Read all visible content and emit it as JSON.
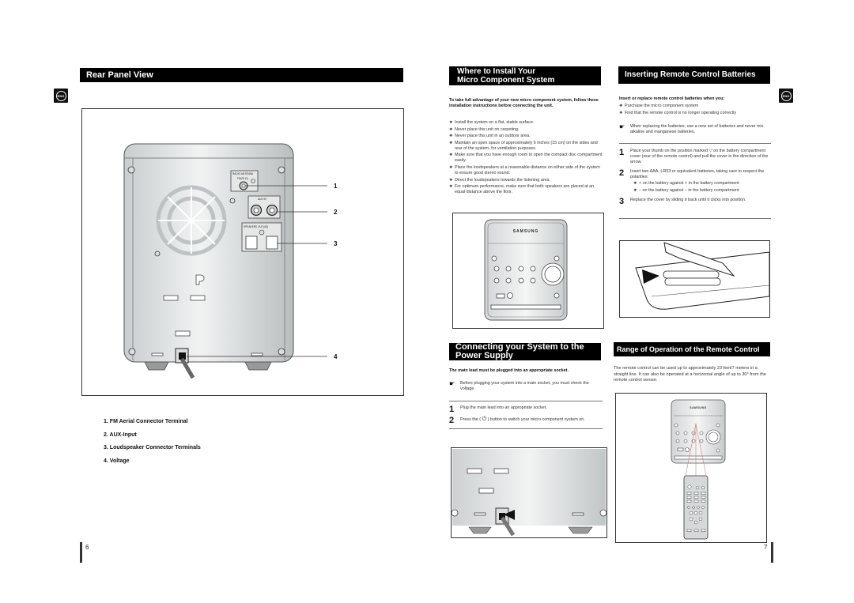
{
  "left_page": {
    "header": "Rear Panel View",
    "language_badge": "ENG",
    "figure": {
      "panel_labels": {
        "radio_antenna": "RADIO ANTENNA",
        "fm": "FM(75 Ω)",
        "aux_in": "AUX IN",
        "speakers_out": "SPEAKERS OUT(4Ω)"
      },
      "callouts": [
        "1",
        "2",
        "3",
        "4"
      ]
    },
    "legend": [
      {
        "num": "1.",
        "label": "FM Aerial Connector Terminal"
      },
      {
        "num": "2.",
        "label": "AUX-Input"
      },
      {
        "num": "3.",
        "label": "Loudspeaker Connector Terminals"
      },
      {
        "num": "4.",
        "label": "Voltage"
      }
    ],
    "page_number": "6"
  },
  "install": {
    "header_line1": "Where to Install Your",
    "header_line2": "Micro Component System",
    "intro": "To take full advantage of your new micro component system, follow these installation instructions before connecting the unit.",
    "bullets": [
      "Install the system on a flat, stable surface.",
      "Never place this unit on carpeting.",
      "Never place this unit in an outdoor area.",
      "Maintain an open space of approximately 6 inches (15 cm) on the sides and rear of the system, for ventilation purposes.",
      "Make sure that you have enough room to open the compact disc compartment easily.",
      "Place the loudspeakers at a reasonable distance on either side of the system to ensure good stereo sound.",
      "Direct the loudspeakers towards the listening area.",
      "For optimum performance, make sure that both speakers are placed at an equal distance above the floor."
    ],
    "brand": "SAMSUNG"
  },
  "power": {
    "header_line1": "Connecting your System to the",
    "header_line2": "Power Supply",
    "intro": "The main lead must be plugged into an appropriate socket.",
    "note": "Before plugging your system into a main socket, you must check the voltage.",
    "steps": [
      {
        "n": "1",
        "text": "Plug the main lead into an appropriate socket."
      },
      {
        "n": "2",
        "text_before": "Press the (",
        "text_after": ") button to switch your micro component system on."
      }
    ]
  },
  "batteries": {
    "header": "Inserting Remote Control Batteries",
    "language_badge": "ENG",
    "intro": "Insert or replace remote control batteries when you:",
    "bullets": [
      "Purchase the micro component system",
      "Find that the remote control is no longer operating correctly"
    ],
    "note": "When replacing the batteries, use a new set of batteries and never mix alkaline and manganese batteries.",
    "steps": [
      {
        "n": "1",
        "text": "Place your thumb on the position marked ▽ on the battery compartment cover (rear of the remote control) and pull the cover in the direction of the arrow."
      },
      {
        "n": "2",
        "text": "Insert two AAA, LR03 or equivalent batteries, taking care to respect the polarities:",
        "sub": [
          "+ on the battery against + in the battery compartment",
          "– on the battery against – in the battery compartment"
        ]
      },
      {
        "n": "3",
        "text": "Replace the cover by sliding it back until it clicks into position."
      }
    ]
  },
  "range": {
    "header": "Range of Operation of the Remote Control",
    "text": "The remote control can be used up to approximately 23 feet/7 meters in a straight line. It can also be operated at a horizontal angle of up to 30° from the remote control sensor.",
    "brand": "SAMSUNG"
  },
  "right_page": {
    "page_number": "7"
  }
}
